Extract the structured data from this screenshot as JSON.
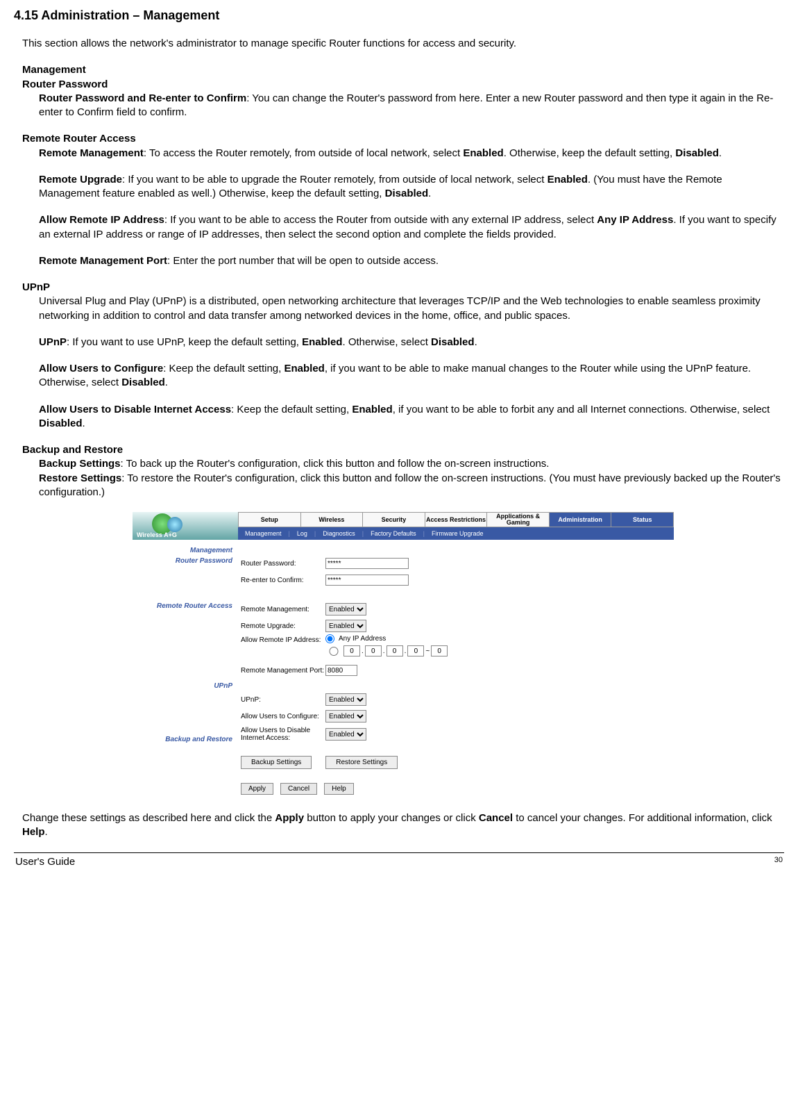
{
  "heading": "4.15 Administration – Management",
  "intro": "This section allows the network's administrator to manage specific Router functions for access and security.",
  "sec": {
    "management": "Management",
    "routerPassword": "Router Password",
    "routerPasswordDesc_b": "Router Password and Re-enter to Confirm",
    "routerPasswordDesc": ": You can change the Router's password from here. Enter a new Router password and then type it again in the Re-enter to Confirm field to confirm.",
    "remoteAccess": "Remote Router Access",
    "remoteMgmt_b": "Remote Management",
    "remoteMgmt1": ": To access the Router remotely, from outside of local network, select ",
    "enabled": "Enabled",
    "remoteMgmt2": ". Otherwise, keep the default setting, ",
    "disabled": "Disabled",
    "period": ".",
    "remoteUpg_b": "Remote Upgrade",
    "remoteUpg1": ": If you want to be able to upgrade the Router remotely, from outside of local network, select ",
    "remoteUpg2": ". (You must have the Remote Management feature enabled as well.) Otherwise, keep the default setting, ",
    "allowIP_b": "Allow Remote IP Address",
    "allowIP1": ": If you want to be able to access the Router from outside with any external IP address, select ",
    "anyIP": "Any IP Address",
    "allowIP2": ". If you want to specify an external IP address or range of IP addresses, then select the second option and complete the fields provided.",
    "remotePort_b": "Remote Management Port",
    "remotePort": ": Enter the port number that will be open to outside access.",
    "upnp": "UPnP",
    "upnpDesc": "Universal Plug and Play (UPnP) is a distributed, open networking architecture that leverages TCP/IP and the Web technologies to enable seamless proximity networking in addition to control and data transfer among networked devices in the home, office, and public spaces.",
    "upnp_b": "UPnP",
    "upnp1": ": If you want to use UPnP, keep the default setting, ",
    "upnp2": ". Otherwise, select ",
    "allowConfig_b": "Allow Users to Configure",
    "allowConfig1": ": Keep the default setting, ",
    "allowConfig2": ", if you want to be able to make manual changes to the Router while using the UPnP feature. Otherwise, select ",
    "allowDisable_b": "Allow Users to Disable Internet Access",
    "allowDisable1": ": Keep the default setting, ",
    "allowDisable2": ", if you want to be able to forbit any and all Internet connections. Otherwise, select ",
    "backupRestore": "Backup and Restore",
    "backup_b": "Backup Settings",
    "backup": ": To back up the Router's configuration, click this button and follow the on-screen instructions.",
    "restore_b": "Restore Settings",
    "restore": ": To restore the Router's configuration, click this button and follow the on-screen instructions. (You must have previously backed up the Router's configuration.)",
    "closing1": "Change these settings as described here and click the ",
    "apply": "Apply",
    "closing2": " button to apply your changes or click ",
    "cancel": "Cancel",
    "closing3": " to cancel your changes. For additional information, click ",
    "help": "Help"
  },
  "ui": {
    "brand": "Wireless A+G",
    "tabs1": [
      "Setup",
      "Wireless",
      "Security",
      "Access Restrictions",
      "Applications & Gaming",
      "Administration",
      "Status"
    ],
    "activeTab": 5,
    "tabs2": [
      "Management",
      "Log",
      "Diagnostics",
      "Factory Defaults",
      "Firmware Upgrade"
    ],
    "side": {
      "management": "Management",
      "routerPassword": "Router Password",
      "remoteAccess": "Remote Router Access",
      "upnp": "UPnP",
      "backupRestore": "Backup and Restore"
    },
    "labels": {
      "routerPassword": "Router Password:",
      "reenter": "Re-enter to Confirm:",
      "remoteMgmt": "Remote Management:",
      "remoteUpgrade": "Remote Upgrade:",
      "allowRemoteIP": "Allow Remote IP Address:",
      "remotePort": "Remote Management Port:",
      "upnp": "UPnP:",
      "allowConfig": "Allow Users to Configure:",
      "allowDisable": "Allow Users to Disable Internet Access:"
    },
    "values": {
      "pwd": "*****",
      "reenter": "*****",
      "remoteMgmt": "Enabled",
      "remoteUpgrade": "Enabled",
      "anyIPLabel": "Any IP Address",
      "ip": [
        "0",
        "0",
        "0",
        "0"
      ],
      "ipEnd": "0",
      "port": "8080",
      "upnp": "Enabled",
      "allowConfig": "Enabled",
      "allowDisable": "Enabled"
    },
    "buttons": {
      "backup": "Backup Settings",
      "restore": "Restore Settings",
      "apply": "Apply",
      "cancel": "Cancel",
      "help": "Help"
    }
  },
  "footer": {
    "guide": "User's Guide",
    "page": "30"
  }
}
